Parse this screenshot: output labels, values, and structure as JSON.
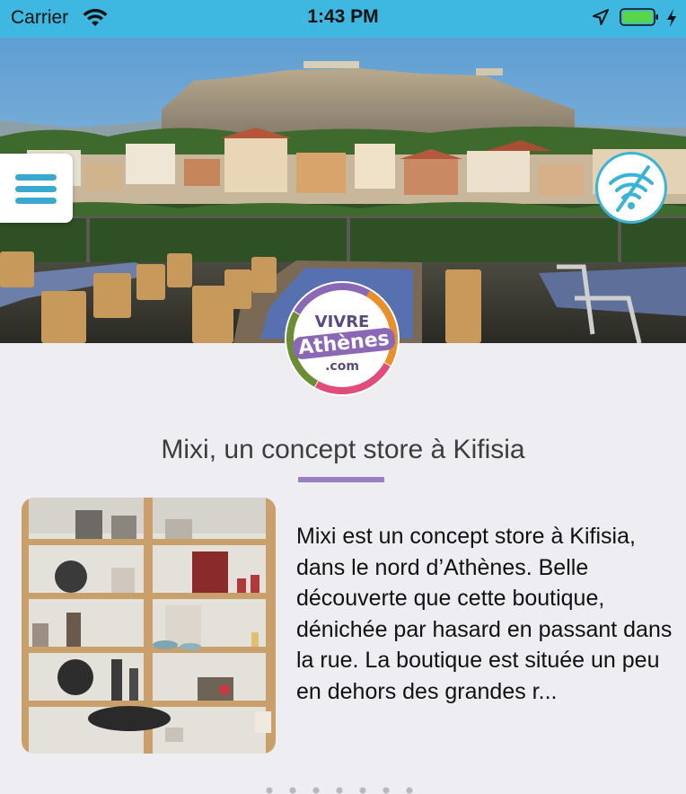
{
  "status_bar": {
    "carrier": "Carrier",
    "time": "1:43 PM",
    "background_color": "#3eb8e0",
    "icons": [
      "wifi-icon",
      "location-arrow-icon",
      "battery-icon",
      "charging-bolt-icon"
    ]
  },
  "hero": {
    "image": "Athens Acropolis rooftop terrace",
    "menu_icon": "hamburger-menu-icon",
    "wifi_icon": "wifi-off-icon"
  },
  "logo": {
    "line1": "VIVRE",
    "line2": "Athènes",
    "line3": ".com"
  },
  "article": {
    "title": "Mixi, un concept store à Kifisia",
    "excerpt": "Mixi est un concept store à Kifisia, dans le nord d’Athènes. Belle découverte que cette boutique, dénichée par hasard en passant dans la rue. La boutique est située un peu en dehors des grandes r...",
    "accent_color": "#9b7dc6"
  },
  "colors": {
    "accent_blue": "#39a9cf",
    "background": "#eeeef2"
  }
}
